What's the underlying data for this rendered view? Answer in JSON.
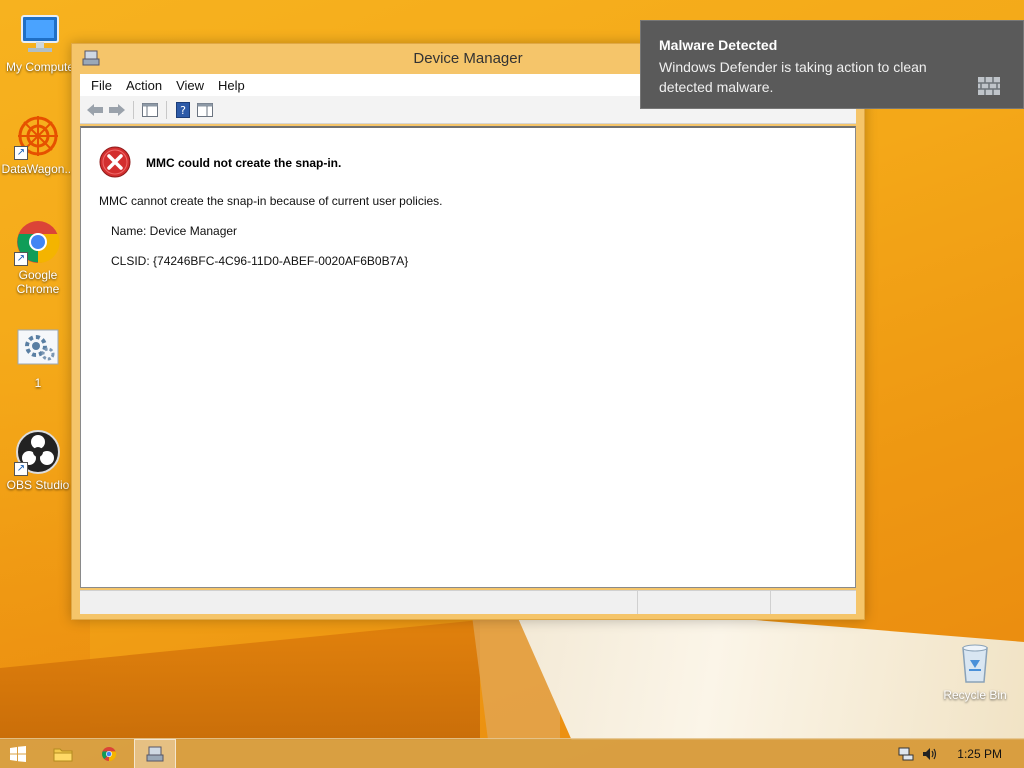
{
  "desktop": {
    "icons": [
      {
        "label": "My Compute",
        "icon": "computer-icon"
      },
      {
        "label": "DataWagon...",
        "icon": "datawagon-icon"
      },
      {
        "label": "Google Chrome",
        "icon": "chrome-icon"
      },
      {
        "label": "1",
        "icon": "settings-file-icon"
      },
      {
        "label": "OBS Studio",
        "icon": "obs-icon"
      },
      {
        "label": "Recycle Bin",
        "icon": "recycle-bin-icon"
      }
    ]
  },
  "window": {
    "title": "Device Manager",
    "menu": [
      "File",
      "Action",
      "View",
      "Help"
    ],
    "toolbar_icons": [
      "back-icon",
      "forward-icon",
      "show-hide-tree-icon",
      "help-icon",
      "properties-icon"
    ],
    "error": {
      "heading": "MMC could not create the snap-in.",
      "message": "MMC cannot create the snap-in because of current user policies.",
      "name_line": "Name: Device Manager",
      "clsid_line": "CLSID: {74246BFC-4C96-11D0-ABEF-0020AF6B0B7A}"
    }
  },
  "notification": {
    "title": "Malware Detected",
    "body": "Windows Defender is taking action to clean detected malware.",
    "icon": "defender-wall-icon"
  },
  "taskbar": {
    "items": [
      "start-icon",
      "file-explorer-icon",
      "chrome-icon",
      "mmc-icon"
    ],
    "active_item": "mmc-icon",
    "tray_icons": [
      "network-icon",
      "volume-icon"
    ],
    "clock": "1:25 PM"
  },
  "colors": {
    "wallpaper": "#f4a818",
    "window_frame": "#f5c56a",
    "toast_bg": "#5a5a5a",
    "error_red": "#d32f2f"
  }
}
